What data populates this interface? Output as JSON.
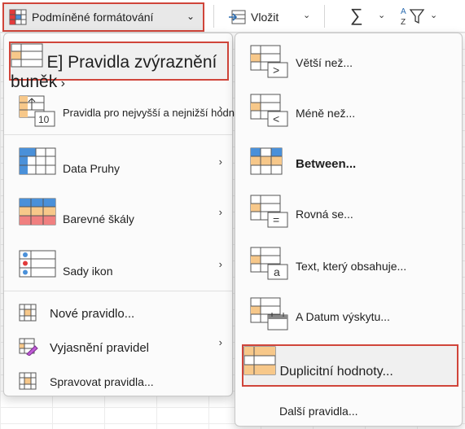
{
  "ribbon": {
    "conditional_formatting_label": "Podmíněné formátování",
    "insert_label": "Vložit",
    "sum_glyph": "∑",
    "sort_glyph": "AZ"
  },
  "main_menu": {
    "items": [
      {
        "label": "E] Pravidla zvýraznění buněk",
        "icon": "highlight-cells-icon",
        "has_submenu": true
      },
      {
        "label": "Pravidla pro nejvyšší a nejnižší hodnoty",
        "icon": "top-bottom-rules-icon",
        "has_submenu": true
      },
      {
        "label": "Data   Pruhy",
        "icon": "data-bars-icon",
        "has_submenu": true
      },
      {
        "label": "Barevné škály",
        "icon": "color-scales-icon",
        "has_submenu": true
      },
      {
        "label": "Sady ikon",
        "icon": "icon-sets-icon",
        "has_submenu": true
      },
      {
        "label": "Nové pravidlo...",
        "icon": "new-rule-icon",
        "has_submenu": false
      },
      {
        "label": "Vyjasnění pravidel",
        "icon": "clear-rules-icon",
        "has_submenu": true
      },
      {
        "label": "Spravovat pravidla...",
        "icon": "manage-rules-icon",
        "has_submenu": false
      }
    ]
  },
  "sub_menu": {
    "items": [
      {
        "label": "Větší než...",
        "icon": "greater-than-icon"
      },
      {
        "label": "Méně než...",
        "icon": "less-than-icon"
      },
      {
        "label": "Between...",
        "icon": "between-icon"
      },
      {
        "label": "Rovná se...",
        "icon": "equal-to-icon"
      },
      {
        "label": "Text, který obsahuje...",
        "icon": "text-contains-icon"
      },
      {
        "label": "A  Datum výskytu...",
        "icon": "date-occurring-icon"
      },
      {
        "label": "Duplicitní hodnoty...",
        "icon": "duplicate-values-icon"
      },
      {
        "label": "Další pravidla...",
        "icon": ""
      }
    ]
  },
  "colors": {
    "highlight_border": "#d0453a",
    "orange_cell": "#f7c88a",
    "blue_cell": "#4a90d9",
    "red_cell": "#f08080"
  }
}
